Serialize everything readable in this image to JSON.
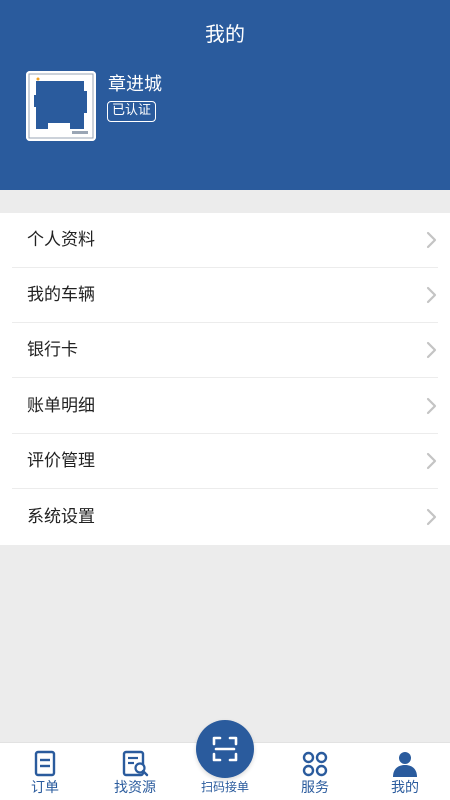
{
  "header": {
    "title": "我的",
    "bg_color": "#2a5b9d"
  },
  "profile": {
    "name": "章进城",
    "badge": "已认证"
  },
  "menu": {
    "items": [
      {
        "label": "个人资料"
      },
      {
        "label": "我的车辆"
      },
      {
        "label": "银行卡"
      },
      {
        "label": "账单明细"
      },
      {
        "label": "评价管理"
      },
      {
        "label": "系统设置"
      }
    ]
  },
  "tabbar": {
    "active_color": "#2a5b9d",
    "items": [
      {
        "label": "订单",
        "icon": "order-icon"
      },
      {
        "label": "找资源",
        "icon": "find-resource-icon"
      },
      {
        "label": "扫码接单",
        "icon": "scan-icon"
      },
      {
        "label": "服务",
        "icon": "service-icon"
      },
      {
        "label": "我的",
        "icon": "profile-icon",
        "active": true
      }
    ]
  }
}
